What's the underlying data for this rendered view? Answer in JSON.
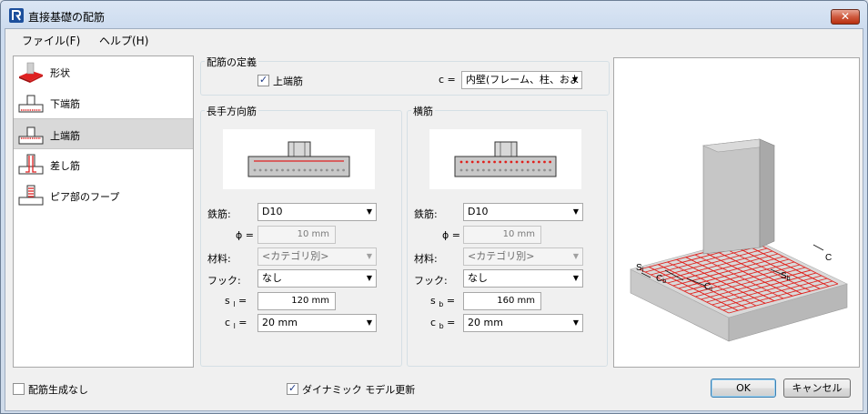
{
  "window": {
    "title": "直接基礎の配筋",
    "close_label": "✕"
  },
  "menu": {
    "file": "ファイル(F)",
    "help": "ヘルプ(H)"
  },
  "sidebar": {
    "items": [
      {
        "label": "形状"
      },
      {
        "label": "下端筋"
      },
      {
        "label": "上端筋"
      },
      {
        "label": "差し筋"
      },
      {
        "label": "ピア部のフープ"
      }
    ]
  },
  "definition": {
    "group_label": "配筋の定義",
    "checkbox_label": "上端筋",
    "checked": true,
    "c_label": "c =",
    "c_value": "内壁(フレーム、柱、およ"
  },
  "longitudinal": {
    "group_label": "長手方向筋",
    "rebar_label": "鉄筋:",
    "rebar_value": "D10",
    "phi_label": "ϕ =",
    "phi_value": "10 mm",
    "material_label": "材料:",
    "material_value": "<カテゴリ別>",
    "hook_label": "フック:",
    "hook_value": "なし",
    "spacing_label": "s",
    "spacing_sub": "l",
    "spacing_eq": "=",
    "spacing_value": "120 mm",
    "cover_label": "c",
    "cover_sub": "l",
    "cover_eq": "=",
    "cover_value": "20 mm"
  },
  "transverse": {
    "group_label": "横筋",
    "rebar_label": "鉄筋:",
    "rebar_value": "D10",
    "phi_label": "ϕ =",
    "phi_value": "10 mm",
    "material_label": "材料:",
    "material_value": "<カテゴリ別>",
    "hook_label": "フック:",
    "hook_value": "なし",
    "spacing_label": "s",
    "spacing_sub": "b",
    "spacing_eq": "=",
    "spacing_value": "160 mm",
    "cover_label": "c",
    "cover_sub": "b",
    "cover_eq": "=",
    "cover_value": "20 mm"
  },
  "view3d_labels": {
    "sl": "S",
    "sl_sub": "l",
    "cb": "C",
    "cb_sub": "b",
    "cl": "C",
    "cl_sub": "l",
    "sb": "S",
    "sb_sub": "b",
    "c": "C"
  },
  "footer": {
    "no_rebar_label": "配筋生成なし",
    "no_rebar_checked": false,
    "dynamic_label": "ダイナミック モデル更新",
    "dynamic_checked": true,
    "ok_label": "OK",
    "cancel_label": "キャンセル"
  },
  "colors": {
    "rebar": "#e0201c",
    "concrete": "#c8c8c8",
    "accent": "#d81e1e"
  }
}
